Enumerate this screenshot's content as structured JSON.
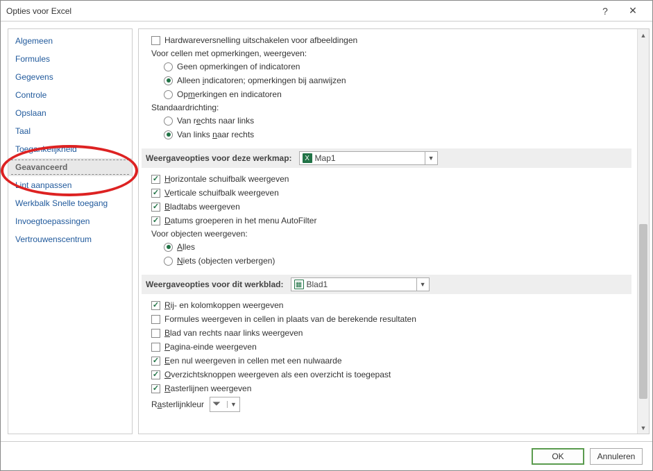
{
  "dialog": {
    "title": "Opties voor Excel"
  },
  "sidebar": {
    "items": [
      {
        "label": "Algemeen"
      },
      {
        "label": "Formules"
      },
      {
        "label": "Gegevens"
      },
      {
        "label": "Controle"
      },
      {
        "label": "Opslaan"
      },
      {
        "label": "Taal"
      },
      {
        "label": "Toegankelijkheid"
      },
      {
        "label": "Geavanceerd"
      },
      {
        "label": "Lint aanpassen"
      },
      {
        "label": "Werkbalk Snelle toegang"
      },
      {
        "label": "Invoegtoepassingen"
      },
      {
        "label": "Vertrouwenscentrum"
      }
    ],
    "selected_index": 7
  },
  "content": {
    "top": {
      "hw_accel": "Hardwareversnelling uitschakelen voor afbeeldingen",
      "comments_label": "Voor cellen met opmerkingen, weergeven:",
      "comments_opt1": "Geen opmerkingen of indicatoren",
      "comments_opt2": "Alleen indicatoren; opmerkingen bij aanwijzen",
      "comments_opt3": "Opmerkingen en indicatoren",
      "direction_label": "Standaardrichting:",
      "direction_opt1": "Van rechts naar links",
      "direction_opt2": "Van links naar rechts"
    },
    "workbook": {
      "header": "Weergaveopties voor deze werkmap:",
      "selected": "Map1",
      "hscroll": "Horizontale schuifbalk weergeven",
      "vscroll": "Verticale schuifbalk weergeven",
      "tabs": "Bladtabs weergeven",
      "dates": "Datums groeperen in het menu AutoFilter",
      "objects_label": "Voor objecten weergeven:",
      "objects_opt1": "Alles",
      "objects_opt2": "Niets (objecten verbergen)"
    },
    "worksheet": {
      "header": "Weergaveopties voor dit werkblad:",
      "selected": "Blad1",
      "rowcol": "Rij- en kolomkoppen weergeven",
      "formulas": "Formules weergeven in cellen in plaats van de berekende resultaten",
      "rtl": "Blad van rechts naar links weergeven",
      "pagebreak": "Pagina-einde weergeven",
      "zero": "Een nul weergeven in cellen met een nulwaarde",
      "outline": "Overzichtsknoppen weergeven als een overzicht is toegepast",
      "grid": "Rasterlijnen weergeven",
      "gridcolor": "Rasterlijnkleur"
    }
  },
  "footer": {
    "ok": "OK",
    "cancel": "Annuleren"
  }
}
